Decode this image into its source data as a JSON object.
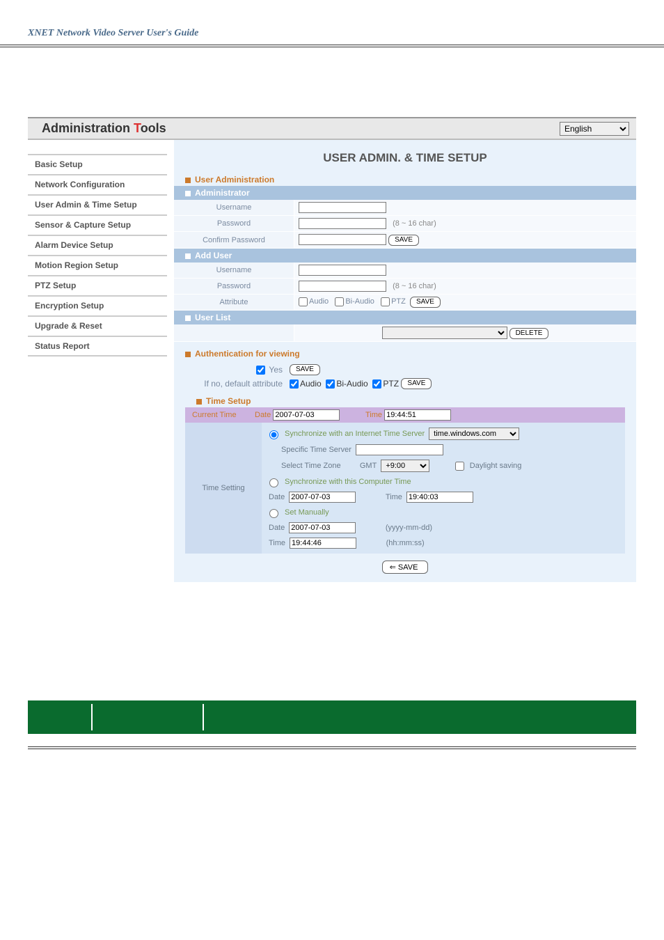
{
  "guide_title": "XNET Network Video Server User's Guide",
  "header": {
    "title_pre": "Administration ",
    "title_accent_char": "T",
    "title_post": "ools",
    "language": "English"
  },
  "sidebar": {
    "items": [
      {
        "label": "Basic Setup"
      },
      {
        "label": "Network Configuration"
      },
      {
        "label": "User Admin & Time Setup"
      },
      {
        "label": "Sensor & Capture Setup"
      },
      {
        "label": "Alarm Device Setup"
      },
      {
        "label": "Motion Region Setup"
      },
      {
        "label": "PTZ Setup"
      },
      {
        "label": "Encryption Setup"
      },
      {
        "label": "Upgrade & Reset"
      },
      {
        "label": "Status Report"
      }
    ]
  },
  "content": {
    "title": "USER ADMIN. & TIME SETUP",
    "user_admin": {
      "heading": "User Administration",
      "administrator": {
        "heading": "Administrator",
        "username_label": "Username",
        "username_value": "",
        "password_label": "Password",
        "password_value": "",
        "password_hint": "(8 ~ 16 char)",
        "confirm_label": "Confirm Password",
        "confirm_value": "",
        "save_label": "SAVE"
      },
      "add_user": {
        "heading": "Add User",
        "username_label": "Username",
        "username_value": "",
        "password_label": "Password",
        "password_value": "",
        "password_hint": "(8 ~ 16 char)",
        "attribute_label": "Attribute",
        "attr_audio": "Audio",
        "attr_biaudio": "Bi-Audio",
        "attr_ptz": "PTZ",
        "save_label": "SAVE"
      },
      "user_list": {
        "heading": "User List",
        "selected": "",
        "delete_label": "DELETE"
      }
    },
    "auth": {
      "heading": "Authentication for viewing",
      "yes_label": "Yes",
      "save_label": "SAVE",
      "default_label": "If no, default attribute",
      "attr_audio": "Audio",
      "attr_biaudio": "Bi-Audio",
      "attr_ptz": "PTZ",
      "save2_label": "SAVE"
    },
    "time": {
      "heading": "Time Setup",
      "current_label": "Current Time",
      "current_date_label": "Date",
      "current_date": "2007-07-03",
      "current_time_label": "Time",
      "current_time": "19:44:51",
      "setting_label": "Time Setting",
      "sync_internet_label": "Synchronize with an Internet Time Server",
      "internet_server": "time.windows.com",
      "specific_server_label": "Specific Time Server",
      "specific_server_value": "",
      "tz_label": "Select Time Zone",
      "tz_gmt_label": "GMT",
      "tz_value": "+9:00",
      "daylight_label": "Daylight saving",
      "sync_computer_label": "Synchronize with this Computer Time",
      "comp_date_label": "Date",
      "comp_date": "2007-07-03",
      "comp_time_label": "Time",
      "comp_time": "19:40:03",
      "manual_label": "Set Manually",
      "man_date_label": "Date",
      "man_date": "2007-07-03",
      "man_date_hint": "(yyyy-mm-dd)",
      "man_time_label": "Time",
      "man_time": "19:44:46",
      "man_time_hint": "(hh:mm:ss)"
    },
    "save_button": "SAVE"
  }
}
